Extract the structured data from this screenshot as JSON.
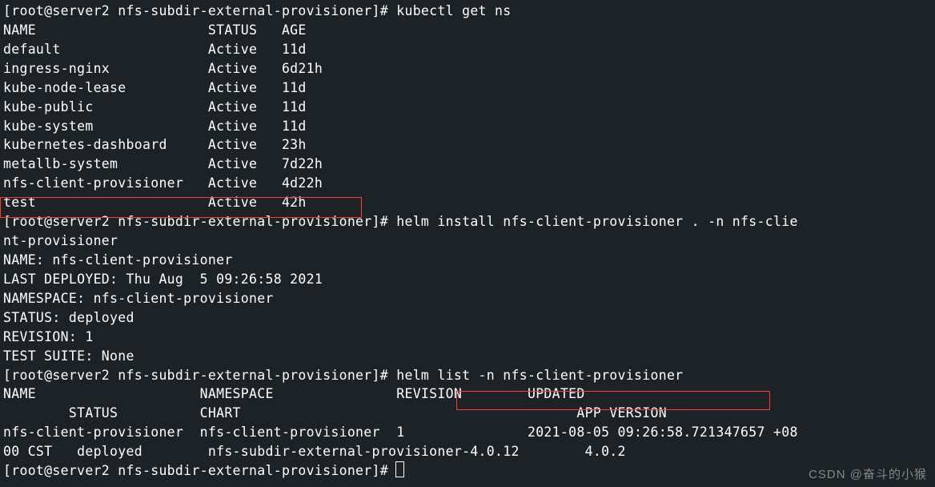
{
  "prompt1": "[root@server2 nfs-subdir-external-provisioner]# ",
  "cmd1": "kubectl get ns",
  "ns_header": "NAME                     STATUS   AGE",
  "ns_rows": [
    "default                  Active   11d",
    "ingress-nginx            Active   6d21h",
    "kube-node-lease          Active   11d",
    "kube-public              Active   11d",
    "kube-system              Active   11d",
    "kubernetes-dashboard     Active   23h",
    "metallb-system           Active   7d22h",
    "nfs-client-provisioner   Active   4d22h",
    "test                     Active   42h"
  ],
  "prompt2": "[root@server2 nfs-subdir-external-provisioner]# ",
  "cmd2a": "helm install nfs-client-provisioner . -n nfs-clie",
  "cmd2b": "nt-provisioner",
  "helm_out": [
    "NAME: nfs-client-provisioner",
    "LAST DEPLOYED: Thu Aug  5 09:26:58 2021",
    "NAMESPACE: nfs-client-provisioner",
    "STATUS: deployed",
    "REVISION: 1",
    "TEST SUITE: None"
  ],
  "prompt3": "[root@server2 nfs-subdir-external-provisioner]# ",
  "cmd3": "helm list -n nfs-client-provisioner",
  "list_header1": "NAME                    NAMESPACE               REVISION        UPDATED                        ",
  "list_header2": "        STATUS          CHART                                         APP VERSION",
  "list_row1": "nfs-client-provisioner  nfs-client-provisioner  1               2021-08-05 09:26:58.721347657 +08",
  "list_row2": "00 CST   deployed        nfs-subdir-external-provisioner-4.0.12        4.0.2      ",
  "prompt4": "[root@server2 nfs-subdir-external-provisioner]# ",
  "watermark": "CSDN @奋斗的小猴"
}
